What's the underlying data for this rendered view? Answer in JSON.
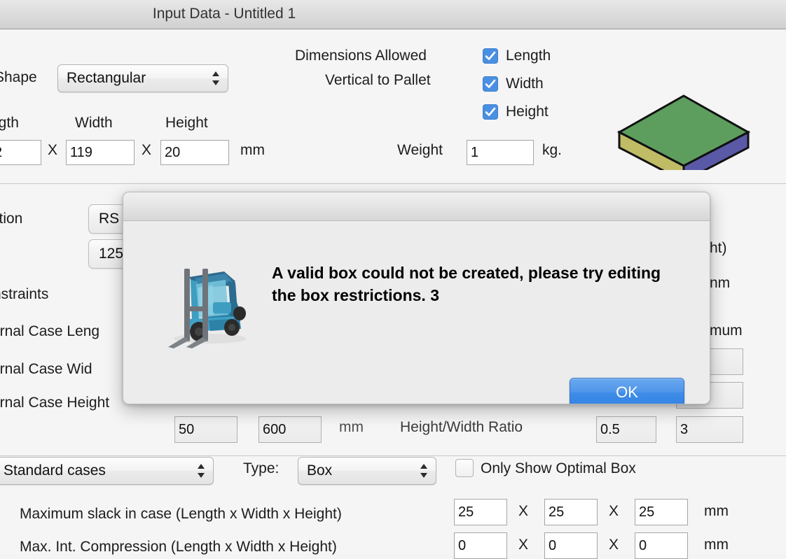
{
  "window": {
    "title": "Input Data - Untitled 1"
  },
  "product": {
    "shape_label": "Shape",
    "shape_value": "Rectangular",
    "length_label": "ngth",
    "width_label": "Width",
    "height_label": "Height",
    "length_value": "2",
    "width_value": "119",
    "height_value": "20",
    "x1": "X",
    "x2": "X",
    "unit": "mm"
  },
  "orientation": {
    "title_line1": "Dimensions Allowed",
    "title_line2": "Vertical to Pallet",
    "checkboxes": [
      {
        "label": "Length",
        "checked": true
      },
      {
        "label": "Width",
        "checked": true
      },
      {
        "label": "Height",
        "checked": true
      }
    ],
    "weight_label": "Weight",
    "weight_value": "1",
    "weight_unit": "kg."
  },
  "preview": {
    "top_color": "#5d9e5f",
    "left_color": "#c0bc66",
    "right_color": "#5a59a8",
    "edge_color": "#111111"
  },
  "case_section": {
    "construction_label": "ction",
    "construction_value": "RS",
    "board_value": "125",
    "constraints_label": "nstraints",
    "rows": [
      {
        "label": "ernal Case Leng",
        "min": "",
        "max": ""
      },
      {
        "label": "ernal Case Wid",
        "min": "",
        "max": ""
      },
      {
        "label": "ernal Case Height",
        "min": "50",
        "max": "600"
      }
    ],
    "unit": "mm",
    "ratio_label": "Height/Width Ratio",
    "ratio_min": "0.5",
    "ratio_max": "3",
    "right_header_height": "ht)",
    "right_header_unit": "nm",
    "right_header_maximum": "mum",
    "right_values": [
      "",
      "",
      "3"
    ]
  },
  "bottom_section": {
    "case_source": "Standard cases",
    "type_label": "Type:",
    "type_value": "Box",
    "optimal_label": "Only Show Optimal Box",
    "optimal_checked": false,
    "slack_label": "Maximum slack in case  (Length x Width x Height)",
    "slack_values": [
      "25",
      "25",
      "25"
    ],
    "slack_unit": "mm",
    "compression_label": "Max. Int. Compression (Length x Width x Height)",
    "compression_values": [
      "0",
      "0",
      "0"
    ],
    "compression_unit": "mm",
    "x_sep": "X"
  },
  "dialog": {
    "message": "A valid box could not be created, please try editing the box restrictions. 3",
    "ok_label": "OK",
    "icon": "forklift-icon"
  }
}
